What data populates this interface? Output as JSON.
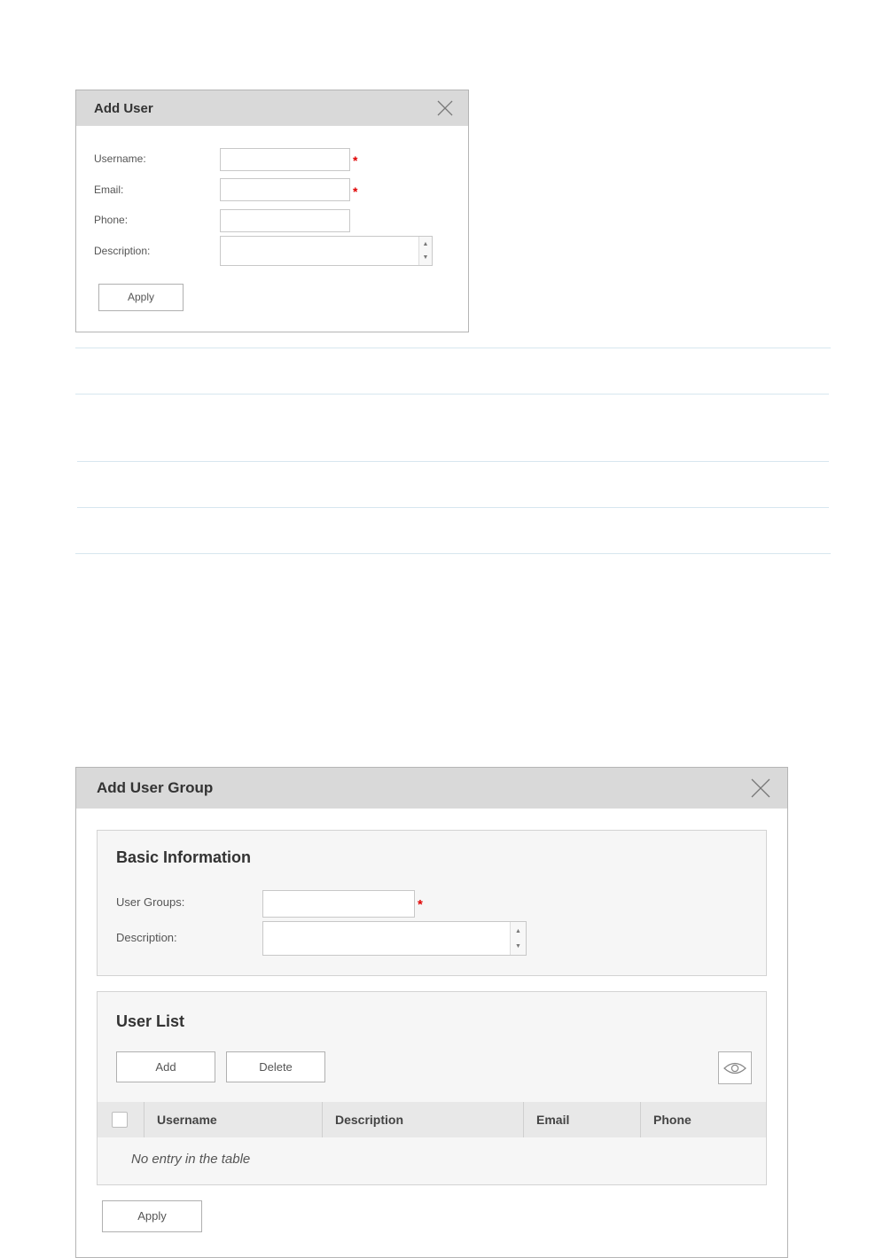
{
  "add_user": {
    "title": "Add User",
    "fields": {
      "username_label": "Username:",
      "email_label": "Email:",
      "phone_label": "Phone:",
      "description_label": "Description:"
    },
    "required_mark": "*",
    "apply_label": "Apply"
  },
  "add_user_group": {
    "title": "Add User Group",
    "basic_info": {
      "title": "Basic Information",
      "user_groups_label": "User Groups:",
      "description_label": "Description:"
    },
    "required_mark": "*",
    "user_list": {
      "title": "User List",
      "add_label": "Add",
      "delete_label": "Delete",
      "columns": [
        "Username",
        "Description",
        "Email",
        "Phone"
      ],
      "empty_message": "No entry in the table"
    },
    "apply_label": "Apply"
  },
  "icons": {
    "close": "close-icon",
    "view": "eye-icon",
    "spin_up": "▲",
    "spin_down": "▼"
  },
  "colors": {
    "header_bg": "#d9d9d9",
    "required": "#e00000",
    "divider": "#d7e6ef"
  }
}
